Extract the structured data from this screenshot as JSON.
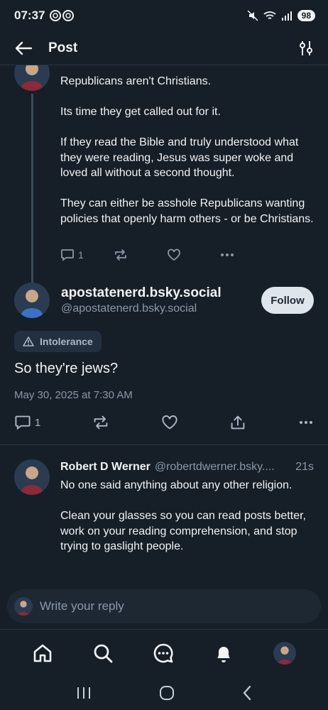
{
  "status_bar": {
    "time": "07:37",
    "battery": "98"
  },
  "header": {
    "title": "Post"
  },
  "parent_post": {
    "paragraphs": [
      "Republicans aren't Christians.",
      "Its time they get called out for it.",
      "If they read the Bible and truly understood what they were reading, Jesus was super woke and loved all without a second thought.",
      "They can either be asshole Republicans wanting policies that openly harm others - or be Christians."
    ],
    "reply_count": "1"
  },
  "main_post": {
    "display_name": "apostatenerd.bsky.social",
    "handle": "@apostatenerd.bsky.social",
    "follow_label": "Follow",
    "label": "Intolerance",
    "text": "So they're jews?",
    "date": "May 30, 2025 at 7:30 AM",
    "reply_count": "1"
  },
  "reply": {
    "name": "Robert D Werner",
    "handle": "@robertdwerner.bsky....",
    "time": "21s",
    "paragraphs": [
      "No one said anything about any other religion.",
      "Clean your glasses so you can read posts better, work on your reading comprehension, and stop trying to gaslight people."
    ]
  },
  "composer": {
    "placeholder": "Write your reply"
  },
  "colors": {
    "background": "#161e27",
    "accent": "#dfe5ec",
    "muted": "#8a99a9"
  }
}
